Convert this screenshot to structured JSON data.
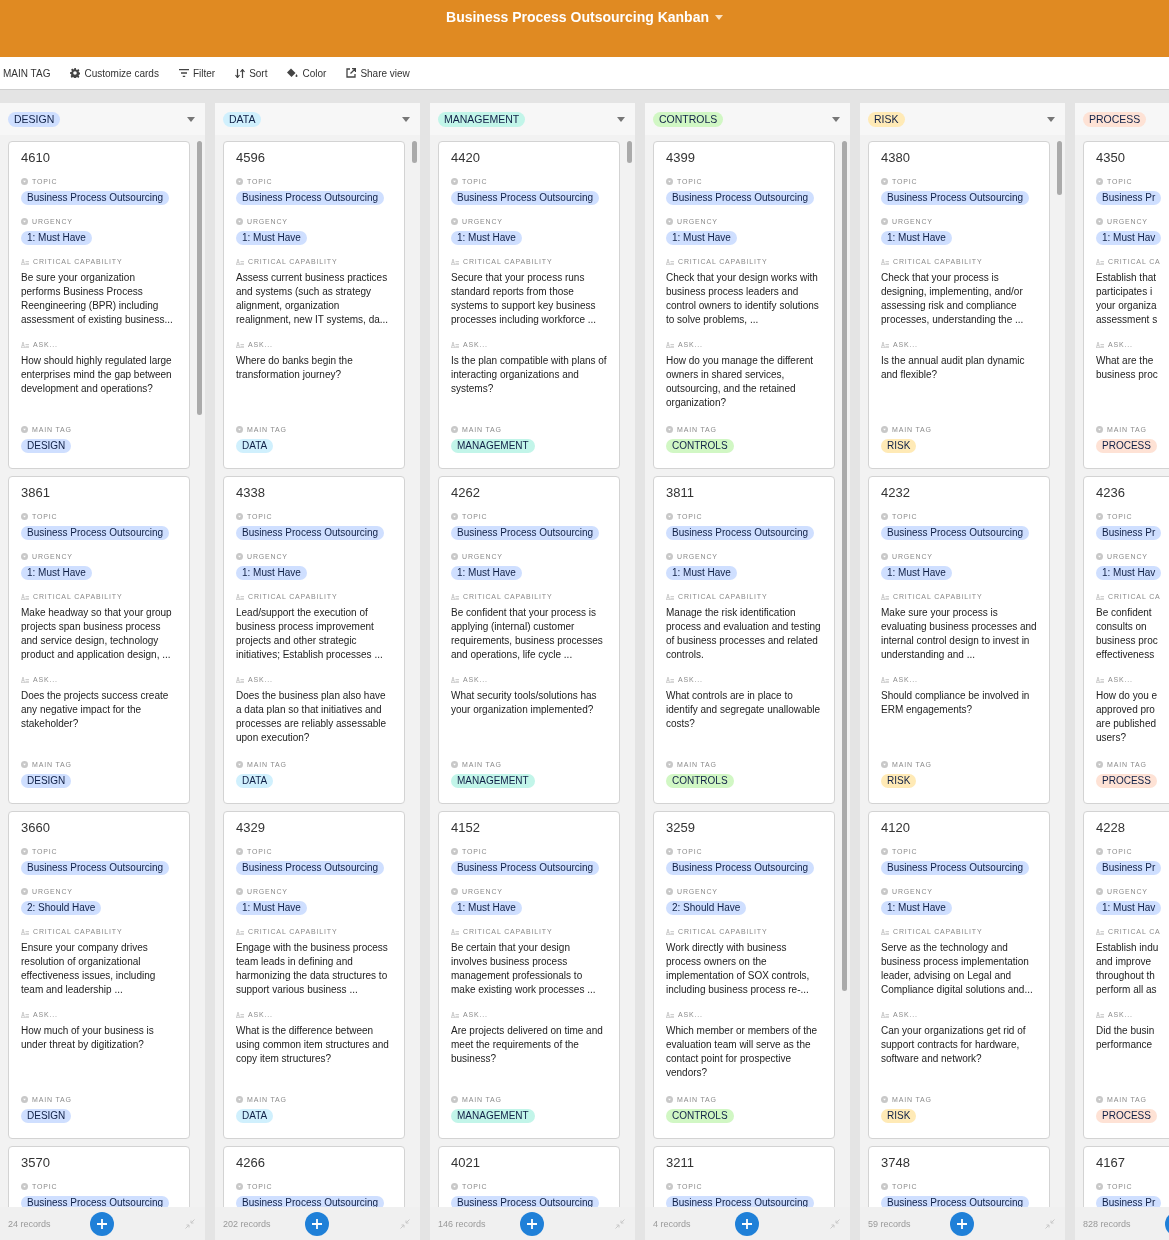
{
  "app": {
    "title": "Business Process Outsourcing Kanban"
  },
  "toolbar": [
    {
      "kind": "group",
      "label": "MAIN TAG"
    },
    {
      "kind": "customize",
      "label": "Customize cards"
    },
    {
      "kind": "filter",
      "label": "Filter"
    },
    {
      "kind": "sort",
      "label": "Sort"
    },
    {
      "kind": "color",
      "label": "Color"
    },
    {
      "kind": "share",
      "label": "Share view"
    }
  ],
  "columns": [
    {
      "name": "DESIGN",
      "color": "#cfdfff",
      "records": "24 records",
      "cards": [
        {
          "number": "4610",
          "fields": [
            {
              "kind": "select",
              "label": "TOPIC",
              "value": "Business Process Outsourcing"
            },
            {
              "kind": "select",
              "label": "URGENCY",
              "value": "1: Must Have"
            },
            {
              "kind": "text",
              "label": "CRITICAL CAPABILITY",
              "value": "Be sure your organization performs Business Process Reengineering (BPR) including assessment of existing business..."
            },
            {
              "kind": "text",
              "label": "ASK...",
              "value": "How should highly regulated large enterprises mind the gap between development and operations?"
            },
            {
              "kind": "tag",
              "label": "MAIN TAG",
              "value": "DESIGN"
            }
          ]
        },
        {
          "number": "3861",
          "fields": [
            {
              "kind": "select",
              "label": "TOPIC",
              "value": "Business Process Outsourcing"
            },
            {
              "kind": "select",
              "label": "URGENCY",
              "value": "1: Must Have"
            },
            {
              "kind": "text",
              "label": "CRITICAL CAPABILITY",
              "value": "Make headway so that your group projects span business process and service design, technology product and application design, ..."
            },
            {
              "kind": "text",
              "label": "ASK...",
              "value": "Does the projects success create any negative impact for the stakeholder?"
            },
            {
              "kind": "tag",
              "label": "MAIN TAG",
              "value": "DESIGN"
            }
          ]
        },
        {
          "number": "3660",
          "fields": [
            {
              "kind": "select",
              "label": "TOPIC",
              "value": "Business Process Outsourcing"
            },
            {
              "kind": "select",
              "label": "URGENCY",
              "value": "2: Should Have"
            },
            {
              "kind": "text",
              "label": "CRITICAL CAPABILITY",
              "value": "Ensure your company drives resolution of organizational effectiveness issues, including team and leadership ..."
            },
            {
              "kind": "text",
              "label": "ASK...",
              "value": "How much of your business is under threat by digitization?"
            },
            {
              "kind": "tag",
              "label": "MAIN TAG",
              "value": "DESIGN"
            }
          ]
        },
        {
          "number": "3570",
          "fields": [
            {
              "kind": "select",
              "label": "TOPIC",
              "value": "Business Process Outsourcing"
            }
          ]
        }
      ]
    },
    {
      "name": "DATA",
      "color": "#d0f0fd",
      "records": "202 records",
      "cards": [
        {
          "number": "4596",
          "fields": [
            {
              "kind": "select",
              "label": "TOPIC",
              "value": "Business Process Outsourcing"
            },
            {
              "kind": "select",
              "label": "URGENCY",
              "value": "1: Must Have"
            },
            {
              "kind": "text",
              "label": "CRITICAL CAPABILITY",
              "value": "Assess current business practices and systems (such as strategy alignment, organization realignment, new IT systems, da..."
            },
            {
              "kind": "text",
              "label": "ASK...",
              "value": "Where do banks begin the transformation journey?"
            },
            {
              "kind": "tag",
              "label": "MAIN TAG",
              "value": "DATA"
            }
          ]
        },
        {
          "number": "4338",
          "fields": [
            {
              "kind": "select",
              "label": "TOPIC",
              "value": "Business Process Outsourcing"
            },
            {
              "kind": "select",
              "label": "URGENCY",
              "value": "1: Must Have"
            },
            {
              "kind": "text",
              "label": "CRITICAL CAPABILITY",
              "value": "Lead/support the execution of business process improvement projects and other strategic initiatives; Establish processes ..."
            },
            {
              "kind": "text",
              "label": "ASK...",
              "value": "Does the business plan also have a data plan so that initiatives and processes are reliably assessable upon execution?"
            },
            {
              "kind": "tag",
              "label": "MAIN TAG",
              "value": "DATA"
            }
          ]
        },
        {
          "number": "4329",
          "fields": [
            {
              "kind": "select",
              "label": "TOPIC",
              "value": "Business Process Outsourcing"
            },
            {
              "kind": "select",
              "label": "URGENCY",
              "value": "1: Must Have"
            },
            {
              "kind": "text",
              "label": "CRITICAL CAPABILITY",
              "value": "Engage with the business process team leads in defining and harmonizing the data structures to support various business ..."
            },
            {
              "kind": "text",
              "label": "ASK...",
              "value": "What is the difference between using common item structures and copy item structures?"
            },
            {
              "kind": "tag",
              "label": "MAIN TAG",
              "value": "DATA"
            }
          ]
        },
        {
          "number": "4266",
          "fields": [
            {
              "kind": "select",
              "label": "TOPIC",
              "value": "Business Process Outsourcing"
            }
          ]
        }
      ]
    },
    {
      "name": "MANAGEMENT",
      "color": "#c2f5e9",
      "records": "146 records",
      "cards": [
        {
          "number": "4420",
          "fields": [
            {
              "kind": "select",
              "label": "TOPIC",
              "value": "Business Process Outsourcing"
            },
            {
              "kind": "select",
              "label": "URGENCY",
              "value": "1: Must Have"
            },
            {
              "kind": "text",
              "label": "CRITICAL CAPABILITY",
              "value": "Secure that your process runs standard reports from those systems to support key business processes including workforce ..."
            },
            {
              "kind": "text",
              "label": "ASK...",
              "value": "Is the plan compatible with plans of interacting organizations and systems?"
            },
            {
              "kind": "tag",
              "label": "MAIN TAG",
              "value": "MANAGEMENT"
            }
          ]
        },
        {
          "number": "4262",
          "fields": [
            {
              "kind": "select",
              "label": "TOPIC",
              "value": "Business Process Outsourcing"
            },
            {
              "kind": "select",
              "label": "URGENCY",
              "value": "1: Must Have"
            },
            {
              "kind": "text",
              "label": "CRITICAL CAPABILITY",
              "value": "Be confident that your process is applying (internal) customer requirements, business processes and operations, life cycle ..."
            },
            {
              "kind": "text",
              "label": "ASK...",
              "value": "What security tools/solutions has your organization implemented?"
            },
            {
              "kind": "tag",
              "label": "MAIN TAG",
              "value": "MANAGEMENT"
            }
          ]
        },
        {
          "number": "4152",
          "fields": [
            {
              "kind": "select",
              "label": "TOPIC",
              "value": "Business Process Outsourcing"
            },
            {
              "kind": "select",
              "label": "URGENCY",
              "value": "1: Must Have"
            },
            {
              "kind": "text",
              "label": "CRITICAL CAPABILITY",
              "value": "Be certain that your design involves business process management professionals to make existing work processes ..."
            },
            {
              "kind": "text",
              "label": "ASK...",
              "value": "Are projects delivered on time and meet the requirements of the business?"
            },
            {
              "kind": "tag",
              "label": "MAIN TAG",
              "value": "MANAGEMENT"
            }
          ]
        },
        {
          "number": "4021",
          "fields": [
            {
              "kind": "select",
              "label": "TOPIC",
              "value": "Business Process Outsourcing"
            }
          ]
        }
      ]
    },
    {
      "name": "CONTROLS",
      "color": "#d1f7c4",
      "records": "4 records",
      "cards": [
        {
          "number": "4399",
          "fields": [
            {
              "kind": "select",
              "label": "TOPIC",
              "value": "Business Process Outsourcing"
            },
            {
              "kind": "select",
              "label": "URGENCY",
              "value": "1: Must Have"
            },
            {
              "kind": "text",
              "label": "CRITICAL CAPABILITY",
              "value": "Check that your design works with business process leaders and control owners to identify solutions to solve problems, ..."
            },
            {
              "kind": "text",
              "label": "ASK...",
              "value": "How do you manage the different owners in shared services, outsourcing, and the retained organization?"
            },
            {
              "kind": "tag",
              "label": "MAIN TAG",
              "value": "CONTROLS"
            }
          ]
        },
        {
          "number": "3811",
          "fields": [
            {
              "kind": "select",
              "label": "TOPIC",
              "value": "Business Process Outsourcing"
            },
            {
              "kind": "select",
              "label": "URGENCY",
              "value": "1: Must Have"
            },
            {
              "kind": "text",
              "label": "CRITICAL CAPABILITY",
              "value": "Manage the risk identification process and evaluation and testing of business processes and related controls."
            },
            {
              "kind": "text",
              "label": "ASK...",
              "value": "What controls are in place to identify and segregate unallowable costs?"
            },
            {
              "kind": "tag",
              "label": "MAIN TAG",
              "value": "CONTROLS"
            }
          ]
        },
        {
          "number": "3259",
          "fields": [
            {
              "kind": "select",
              "label": "TOPIC",
              "value": "Business Process Outsourcing"
            },
            {
              "kind": "select",
              "label": "URGENCY",
              "value": "2: Should Have"
            },
            {
              "kind": "text",
              "label": "CRITICAL CAPABILITY",
              "value": "Work directly with business process owners on the implementation of SOX controls, including business process re-..."
            },
            {
              "kind": "text",
              "label": "ASK...",
              "value": "Which member or members of the evaluation team will serve as the contact point for prospective vendors?"
            },
            {
              "kind": "tag",
              "label": "MAIN TAG",
              "value": "CONTROLS"
            }
          ]
        },
        {
          "number": "3211",
          "fields": [
            {
              "kind": "select",
              "label": "TOPIC",
              "value": "Business Process Outsourcing"
            }
          ]
        }
      ]
    },
    {
      "name": "RISK",
      "color": "#ffeab6",
      "records": "59 records",
      "cards": [
        {
          "number": "4380",
          "fields": [
            {
              "kind": "select",
              "label": "TOPIC",
              "value": "Business Process Outsourcing"
            },
            {
              "kind": "select",
              "label": "URGENCY",
              "value": "1: Must Have"
            },
            {
              "kind": "text",
              "label": "CRITICAL CAPABILITY",
              "value": "Check that your process is designing, implementing, and/or assessing risk and compliance processes, understanding the ..."
            },
            {
              "kind": "text",
              "label": "ASK...",
              "value": "Is the annual audit plan dynamic and flexible?"
            },
            {
              "kind": "tag",
              "label": "MAIN TAG",
              "value": "RISK"
            }
          ]
        },
        {
          "number": "4232",
          "fields": [
            {
              "kind": "select",
              "label": "TOPIC",
              "value": "Business Process Outsourcing"
            },
            {
              "kind": "select",
              "label": "URGENCY",
              "value": "1: Must Have"
            },
            {
              "kind": "text",
              "label": "CRITICAL CAPABILITY",
              "value": "Make sure your process is evaluating business processes and internal control design to invest in understanding and ..."
            },
            {
              "kind": "text",
              "label": "ASK...",
              "value": "Should compliance be involved in ERM engagements?"
            },
            {
              "kind": "tag",
              "label": "MAIN TAG",
              "value": "RISK"
            }
          ]
        },
        {
          "number": "4120",
          "fields": [
            {
              "kind": "select",
              "label": "TOPIC",
              "value": "Business Process Outsourcing"
            },
            {
              "kind": "select",
              "label": "URGENCY",
              "value": "1: Must Have"
            },
            {
              "kind": "text",
              "label": "CRITICAL CAPABILITY",
              "value": "Serve as the technology and business process implementation leader, advising on Legal and Compliance digital solutions and..."
            },
            {
              "kind": "text",
              "label": "ASK...",
              "value": "Can your organizations get rid of support contracts for hardware, software and network?"
            },
            {
              "kind": "tag",
              "label": "MAIN TAG",
              "value": "RISK"
            }
          ]
        },
        {
          "number": "3748",
          "fields": [
            {
              "kind": "select",
              "label": "TOPIC",
              "value": "Business Process Outsourcing"
            }
          ]
        }
      ]
    },
    {
      "name": "PROCESS",
      "color": "#fee2d5",
      "records": "828 records",
      "cards": [
        {
          "number": "4350",
          "fields": [
            {
              "kind": "select",
              "label": "TOPIC",
              "value": "Business Pr"
            },
            {
              "kind": "select",
              "label": "URGENCY",
              "value": "1: Must Hav"
            },
            {
              "kind": "text",
              "label": "CRITICAL CA",
              "value": "Establish that\nparticipates i\nyour organiza\nassessment s"
            },
            {
              "kind": "text",
              "label": "ASK...",
              "value": "What are the\nbusiness proc"
            },
            {
              "kind": "tag",
              "label": "MAIN TAG",
              "value": "PROCESS"
            }
          ]
        },
        {
          "number": "4236",
          "fields": [
            {
              "kind": "select",
              "label": "TOPIC",
              "value": "Business Pr"
            },
            {
              "kind": "select",
              "label": "URGENCY",
              "value": "1: Must Hav"
            },
            {
              "kind": "text",
              "label": "CRITICAL CA",
              "value": "Be confident\nconsults on\nbusiness proc\neffectiveness"
            },
            {
              "kind": "text",
              "label": "ASK...",
              "value": "How do you e\napproved pro\nare published\nusers?"
            },
            {
              "kind": "tag",
              "label": "MAIN TAG",
              "value": "PROCESS"
            }
          ]
        },
        {
          "number": "4228",
          "fields": [
            {
              "kind": "select",
              "label": "TOPIC",
              "value": "Business Pr"
            },
            {
              "kind": "select",
              "label": "URGENCY",
              "value": "1: Must Hav"
            },
            {
              "kind": "text",
              "label": "CRITICAL CA",
              "value": "Establish indu\nand improve\nthroughout th\nperform all as"
            },
            {
              "kind": "text",
              "label": "ASK...",
              "value": "Did the busin\nperformance"
            },
            {
              "kind": "tag",
              "label": "MAIN TAG",
              "value": "PROCESS"
            }
          ]
        },
        {
          "number": "4167",
          "fields": [
            {
              "kind": "select",
              "label": "TOPIC",
              "value": "Business Pr"
            }
          ]
        }
      ]
    }
  ]
}
